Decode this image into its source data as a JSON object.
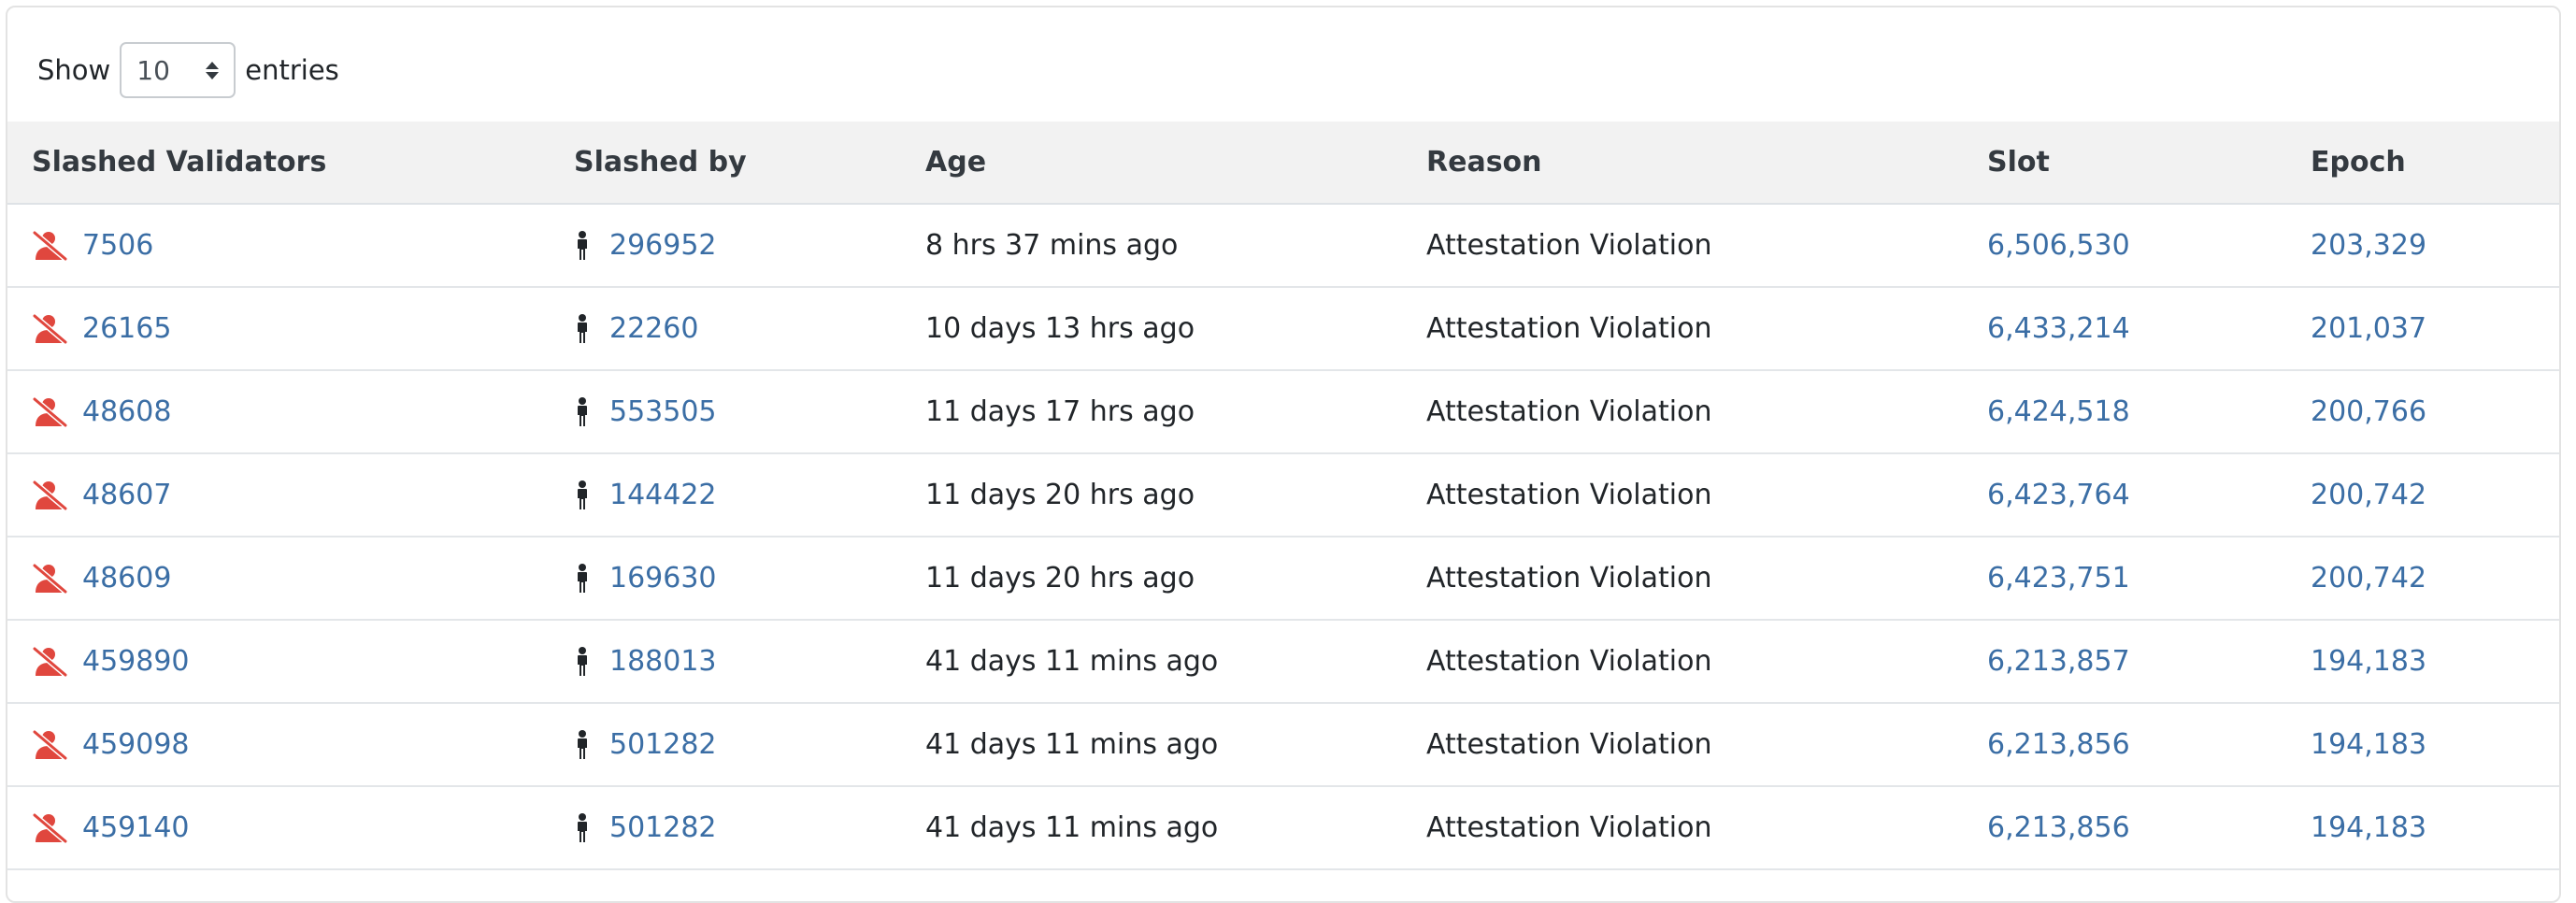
{
  "length_menu": {
    "show_label": "Show",
    "selected": "10",
    "entries_label": "entries"
  },
  "colors": {
    "link": "#3b6ea5",
    "slashed_icon": "#e0473e",
    "header_bg": "#f2f2f2"
  },
  "icons": {
    "validator": "user-slash-icon",
    "slasher": "male-person-icon",
    "select_caret": "sort-caret-icon"
  },
  "table": {
    "columns": [
      "Slashed Validators",
      "Slashed by",
      "Age",
      "Reason",
      "Slot",
      "Epoch"
    ],
    "rows": [
      {
        "validator": "7506",
        "slashed_by": "296952",
        "age": "8 hrs 37 mins ago",
        "reason": "Attestation Violation",
        "slot": "6,506,530",
        "epoch": "203,329"
      },
      {
        "validator": "26165",
        "slashed_by": "22260",
        "age": "10 days 13 hrs ago",
        "reason": "Attestation Violation",
        "slot": "6,433,214",
        "epoch": "201,037"
      },
      {
        "validator": "48608",
        "slashed_by": "553505",
        "age": "11 days 17 hrs ago",
        "reason": "Attestation Violation",
        "slot": "6,424,518",
        "epoch": "200,766"
      },
      {
        "validator": "48607",
        "slashed_by": "144422",
        "age": "11 days 20 hrs ago",
        "reason": "Attestation Violation",
        "slot": "6,423,764",
        "epoch": "200,742"
      },
      {
        "validator": "48609",
        "slashed_by": "169630",
        "age": "11 days 20 hrs ago",
        "reason": "Attestation Violation",
        "slot": "6,423,751",
        "epoch": "200,742"
      },
      {
        "validator": "459890",
        "slashed_by": "188013",
        "age": "41 days 11 mins ago",
        "reason": "Attestation Violation",
        "slot": "6,213,857",
        "epoch": "194,183"
      },
      {
        "validator": "459098",
        "slashed_by": "501282",
        "age": "41 days 11 mins ago",
        "reason": "Attestation Violation",
        "slot": "6,213,856",
        "epoch": "194,183"
      },
      {
        "validator": "459140",
        "slashed_by": "501282",
        "age": "41 days 11 mins ago",
        "reason": "Attestation Violation",
        "slot": "6,213,856",
        "epoch": "194,183"
      }
    ]
  }
}
